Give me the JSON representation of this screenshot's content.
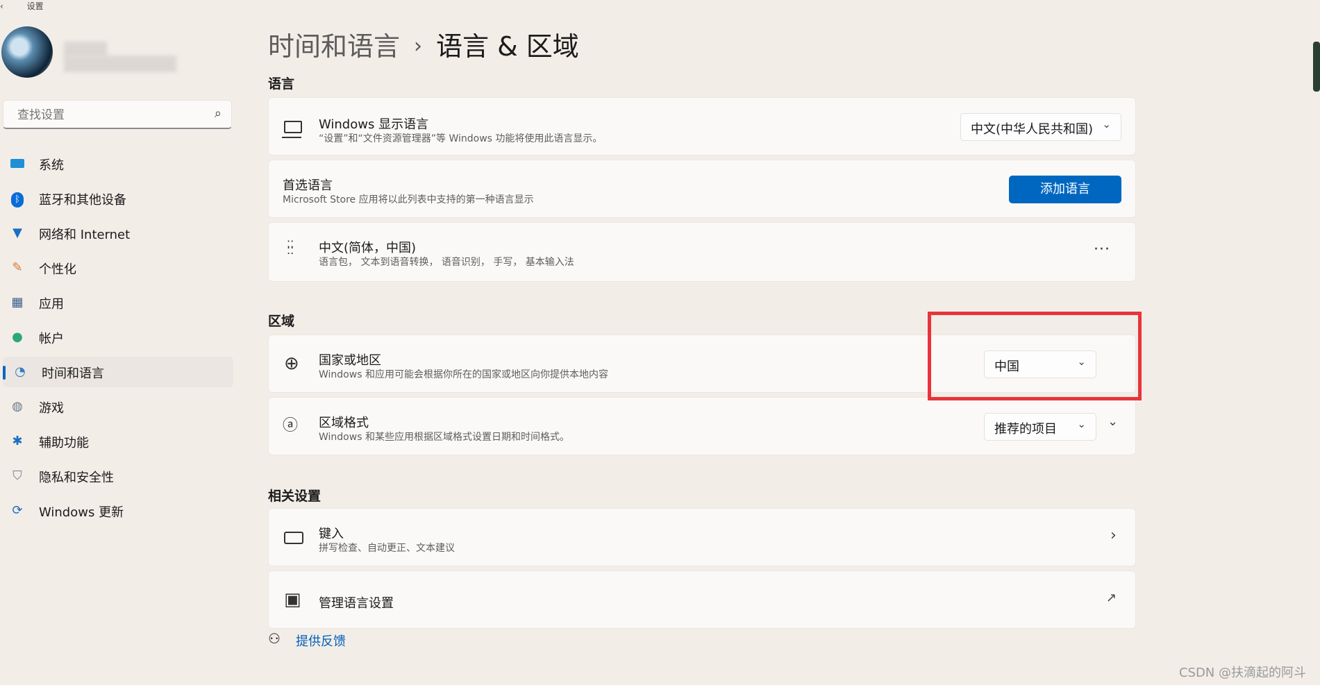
{
  "window": {
    "title": "设置"
  },
  "sidebar": {
    "search_placeholder": "查找设置",
    "items": [
      {
        "label": "系统",
        "icon": "monitor-icon"
      },
      {
        "label": "蓝牙和其他设备",
        "icon": "bluetooth-icon"
      },
      {
        "label": "网络和 Internet",
        "icon": "wifi-icon"
      },
      {
        "label": "个性化",
        "icon": "brush-icon"
      },
      {
        "label": "应用",
        "icon": "apps-icon"
      },
      {
        "label": "帐户",
        "icon": "person-icon"
      },
      {
        "label": "时间和语言",
        "icon": "clock-globe-icon",
        "active": true
      },
      {
        "label": "游戏",
        "icon": "gamepad-icon"
      },
      {
        "label": "辅助功能",
        "icon": "accessibility-icon"
      },
      {
        "label": "隐私和安全性",
        "icon": "shield-icon"
      },
      {
        "label": "Windows 更新",
        "icon": "update-icon"
      }
    ]
  },
  "breadcrumb": {
    "parent": "时间和语言",
    "separator": "›",
    "current": "语言 & 区域"
  },
  "language": {
    "section_title": "语言",
    "display": {
      "title": "Windows 显示语言",
      "subtitle": "“设置”和“文件资源管理器”等 Windows 功能将使用此语言显示。",
      "value": "中文(中华人民共和国)"
    },
    "preferred": {
      "title": "首选语言",
      "subtitle": "Microsoft Store 应用将以此列表中支持的第一种语言显示",
      "button": "添加语言"
    },
    "entry": {
      "title": "中文(简体，中国)",
      "subtitle": "语言包， 文本到语音转换， 语音识别， 手写， 基本输入法",
      "more": "···"
    }
  },
  "region": {
    "section_title": "区域",
    "country": {
      "title": "国家或地区",
      "subtitle": "Windows 和应用可能会根据你所在的国家或地区向你提供本地内容",
      "value": "中国"
    },
    "format": {
      "title": "区域格式",
      "subtitle": "Windows 和某些应用根据区域格式设置日期和时间格式。",
      "value": "推荐的项目"
    }
  },
  "related": {
    "section_title": "相关设置",
    "typing": {
      "title": "键入",
      "subtitle": "拼写检查、自动更正、文本建议"
    },
    "admin": {
      "title": "管理语言设置"
    }
  },
  "feedback": {
    "label": "提供反馈"
  },
  "watermark": "CSDN @扶滴起的阿斗",
  "colors": {
    "accent": "#0067c0",
    "highlight": "#e8343a",
    "background": "#f3ede8"
  }
}
